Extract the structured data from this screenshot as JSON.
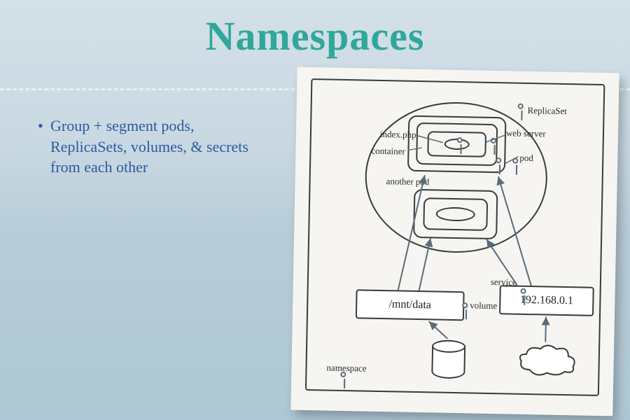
{
  "title": "Namespaces",
  "bullet": "Group + segment pods, ReplicaSets, volumes, & secrets from each other",
  "diagram": {
    "replicaset": "ReplicaSet",
    "index_php": "index.php",
    "web_server": "web server",
    "container": "container",
    "pod": "pod",
    "another_pod": "another pod",
    "service": "service",
    "ip": "192.168.0.1",
    "volume_path": "/mnt/data",
    "volume": "volume",
    "namespace": "namespace"
  }
}
